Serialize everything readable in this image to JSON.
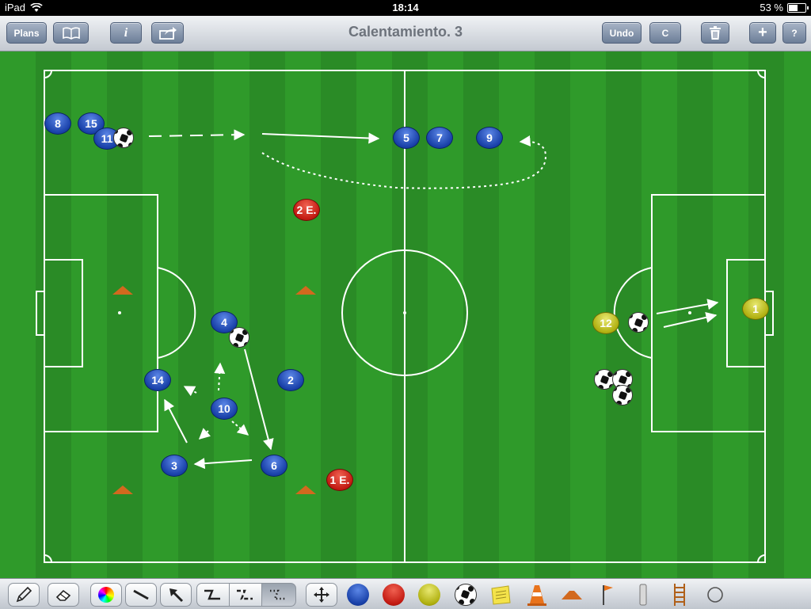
{
  "status": {
    "carrier": "iPad",
    "time": "18:14",
    "battery": "53 %",
    "battery_level": 0.53
  },
  "toolbar": {
    "plans_label": "Plans",
    "title": "Calentamiento. 3",
    "undo_label": "Undo",
    "c_label": "C",
    "add_label": "+",
    "help_label": "?",
    "info_label": "i"
  },
  "players": {
    "p8": "8",
    "p15": "15",
    "p11": "11",
    "p5": "5",
    "p7": "7",
    "p9": "9",
    "e2": "2 E.",
    "p4": "4",
    "p2": "2",
    "p14": "14",
    "p10": "10",
    "p3": "3",
    "p6": "6",
    "e1": "1 E.",
    "y12": "12",
    "y1": "1"
  },
  "colors": {
    "field_stripe_a": "#2f9a2a",
    "field_stripe_b": "#2a8b26",
    "blue_team": "#1840a8",
    "red_team": "#c21a12",
    "yellow_team": "#b0b010",
    "cone": "#d2691e"
  },
  "bottom_tools": [
    "pencil-icon",
    "eraser-icon",
    "color-wheel-icon",
    "line-icon",
    "arrow-icon",
    "zigzag-line-icon",
    "zigzag-dashed-icon",
    "dotted-path-icon",
    "move-icon",
    "blue-player-token",
    "red-player-token",
    "yellow-player-token",
    "ball-icon",
    "note-icon",
    "traffic-cone-icon",
    "flat-cone-icon",
    "corner-flag-icon",
    "pole-icon",
    "ladder-icon",
    "circle-icon"
  ]
}
